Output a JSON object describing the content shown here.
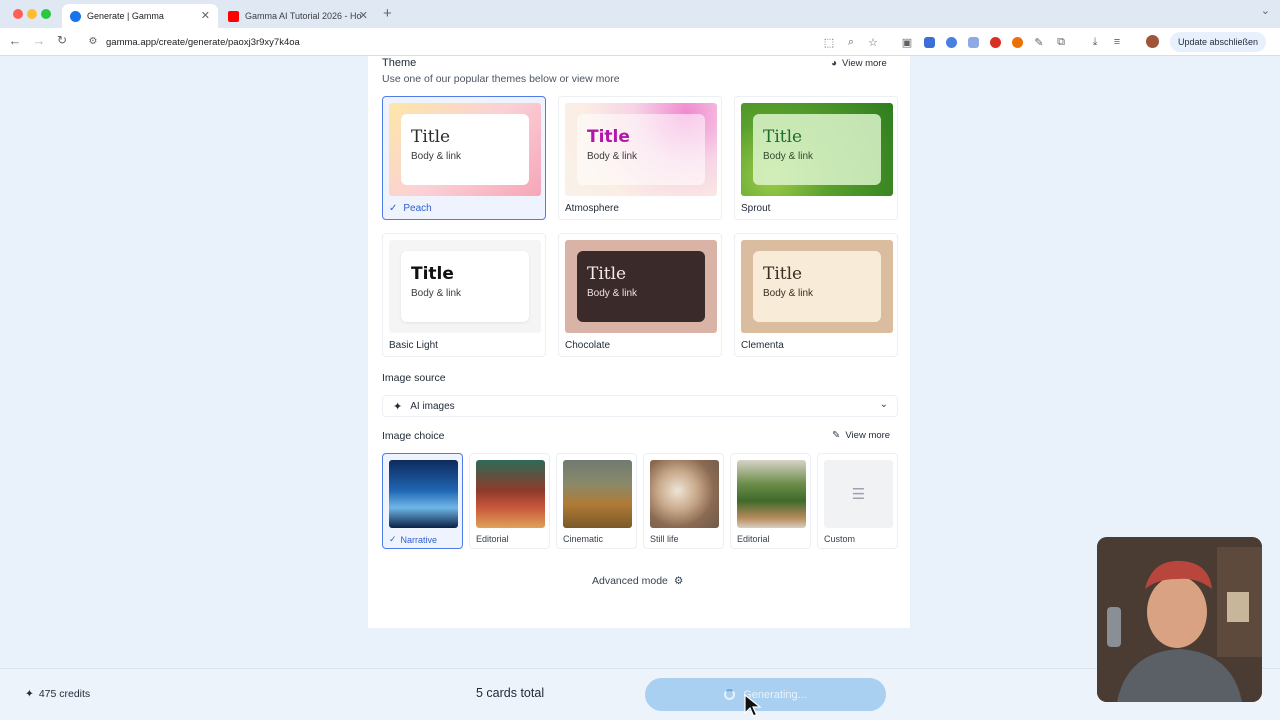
{
  "browser": {
    "tabs": [
      {
        "label": "Generate | Gamma",
        "active": true
      },
      {
        "label": "Gamma AI Tutorial 2026 - Ho",
        "active": false
      }
    ],
    "url": "gamma.app/create/generate/paoxj3r9xy7k4oa",
    "update_label": "Update abschließen"
  },
  "theme": {
    "title": "Theme",
    "subtitle": "Use one of our popular themes below or view more",
    "view_more": "View more",
    "preview_title": "Title",
    "preview_body": "Body & link",
    "cards": [
      {
        "name": "Peach",
        "selected": true
      },
      {
        "name": "Atmosphere",
        "selected": false
      },
      {
        "name": "Sprout",
        "selected": false
      },
      {
        "name": "Basic Light",
        "selected": false
      },
      {
        "name": "Chocolate",
        "selected": false
      },
      {
        "name": "Clementa",
        "selected": false
      }
    ]
  },
  "image_source": {
    "label": "Image source",
    "value": "AI images"
  },
  "image_choice": {
    "label": "Image choice",
    "view_more": "View more",
    "options": [
      {
        "name": "Narrative",
        "selected": true
      },
      {
        "name": "Editorial",
        "selected": false
      },
      {
        "name": "Cinematic",
        "selected": false
      },
      {
        "name": "Still life",
        "selected": false
      },
      {
        "name": "Editorial",
        "selected": false
      },
      {
        "name": "Custom",
        "selected": false
      }
    ]
  },
  "advanced_mode": "Advanced mode",
  "footer": {
    "credits": "475 credits",
    "cards_total": "5 cards total",
    "generate_label": "Generating..."
  },
  "colors": {
    "accent": "#4f7ce8",
    "generate_button": "#a9cff1",
    "page_bg": "#e9f2fb"
  }
}
